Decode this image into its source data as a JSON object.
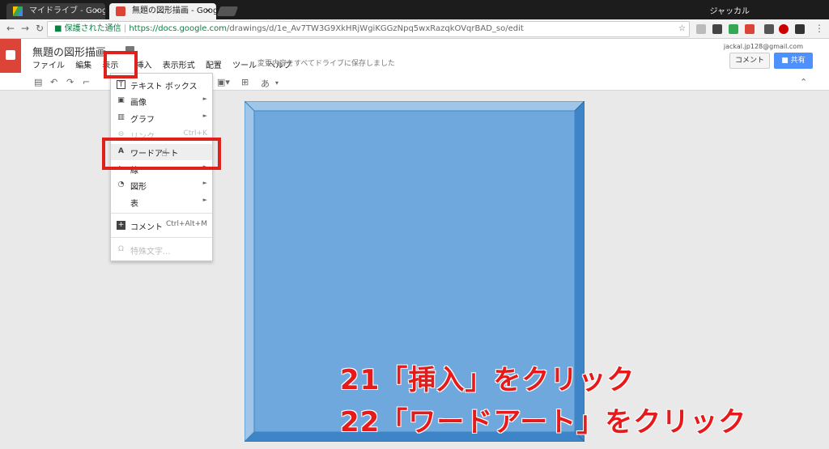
{
  "browser": {
    "tabs": [
      {
        "title": "マイドライブ - Google ドライ",
        "close": "×"
      },
      {
        "title": "無題の図形描画 - Google",
        "close": "×"
      }
    ],
    "profile": "ジャッカル",
    "secure_label": "保護された通信",
    "url_host": "https://docs.google.com",
    "url_path": "/drawings/d/1e_Av7TW3G9XkHRjWgiKGGzNpq5wxRazqkOVqrBAD_so/edit"
  },
  "doc": {
    "title": "無題の図形描画",
    "menus": [
      "ファイル",
      "編集",
      "表示",
      "挿入",
      "表示形式",
      "配置",
      "ツール",
      "ヘルプ"
    ],
    "saved_status": "変更内容をすべてドライブに保存しました",
    "account": "jackal.jp128@gmail.com",
    "comment_button": "コメント",
    "share_button": "共有"
  },
  "insert_menu": {
    "items": [
      {
        "label": "テキスト ボックス",
        "icon": "text-box-icon",
        "glyph": "T",
        "submenu": false
      },
      {
        "label": "画像",
        "icon": "image-icon",
        "glyph": "▣",
        "submenu": true
      },
      {
        "label": "グラフ",
        "icon": "chart-icon",
        "glyph": "▥",
        "submenu": true
      },
      {
        "label": "リンク",
        "icon": "link-icon",
        "glyph": "⊖",
        "shortcut": "Ctrl+K",
        "disabled": true
      },
      {
        "label": "ワードアート",
        "icon": "wordart-icon",
        "glyph": "A",
        "submenu": false
      },
      {
        "label": "線",
        "icon": "line-icon",
        "glyph": "↘",
        "submenu": true
      },
      {
        "label": "図形",
        "icon": "shape-icon",
        "glyph": "◔",
        "submenu": true
      },
      {
        "label": "表",
        "icon": "table-icon",
        "glyph": "",
        "submenu": true
      },
      {
        "label": "コメント",
        "icon": "comment-icon",
        "glyph": "+",
        "shortcut": "Ctrl+Alt+M"
      },
      {
        "label": "特殊文字...",
        "icon": "omega-icon",
        "glyph": "Ω",
        "disabled": true
      }
    ]
  },
  "toolbar": {
    "font_char": "あ"
  },
  "annotations": {
    "step21": "21「挿入」をクリック",
    "step22": "22「ワードアート」をクリック"
  },
  "colors": {
    "shape_fill": "#6fa8dc",
    "shape_border": "#3d85c6",
    "annotation": "#e61a1a",
    "share": "#4d90fe"
  }
}
